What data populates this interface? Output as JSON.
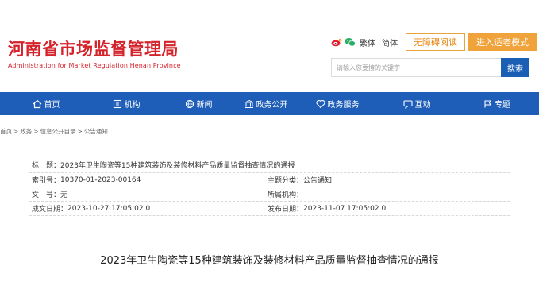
{
  "header": {
    "logo_cn": "河南省市场监督管理局",
    "logo_en": "Administration for Market Regulation Henan Province",
    "lang_traditional": "繁体",
    "lang_simplified": "简体",
    "accessible_button": "无障碍阅读",
    "elder_mode_button": "进入适老模式",
    "search_placeholder": "请输入您要搜的关键字",
    "search_button": "搜索"
  },
  "nav": {
    "items": [
      {
        "label": "首页",
        "icon": "home-icon"
      },
      {
        "label": "机构",
        "icon": "organization-icon"
      },
      {
        "label": "新闻",
        "icon": "news-icon"
      },
      {
        "label": "政务公开",
        "icon": "government-icon"
      },
      {
        "label": "政务服务",
        "icon": "service-icon"
      },
      {
        "label": "互动",
        "icon": "interaction-icon"
      },
      {
        "label": "专题",
        "icon": "topic-icon"
      }
    ]
  },
  "breadcrumb": [
    "首页",
    "政务",
    "信息公开目录",
    "公告通知"
  ],
  "meta": {
    "title_label": "标　题：",
    "title_value": "2023年卫生陶瓷等15种建筑装饰及装修材料产品质量监督抽查情况的通报",
    "index_label": "索引号：",
    "index_value": "10370-01-2023-00164",
    "category_label": "主题分类：",
    "category_value": "公告通知",
    "docno_label": "文　号：",
    "docno_value": "无",
    "org_label": "所属机构：",
    "org_value": "",
    "created_label": "成文日期：",
    "created_value": "2023-10-27 17:05:02.0",
    "published_label": "发布日期：",
    "published_value": "2023-11-07 17:05:02.0"
  },
  "article": {
    "title": "2023年卫生陶瓷等15种建筑装饰及装修材料产品质量监督抽查情况的通报"
  },
  "colors": {
    "brand_red": "#d4232b",
    "nav_blue": "#1f5eb8",
    "search_blue": "#1a5fb4",
    "orange": "#f0a33a"
  }
}
